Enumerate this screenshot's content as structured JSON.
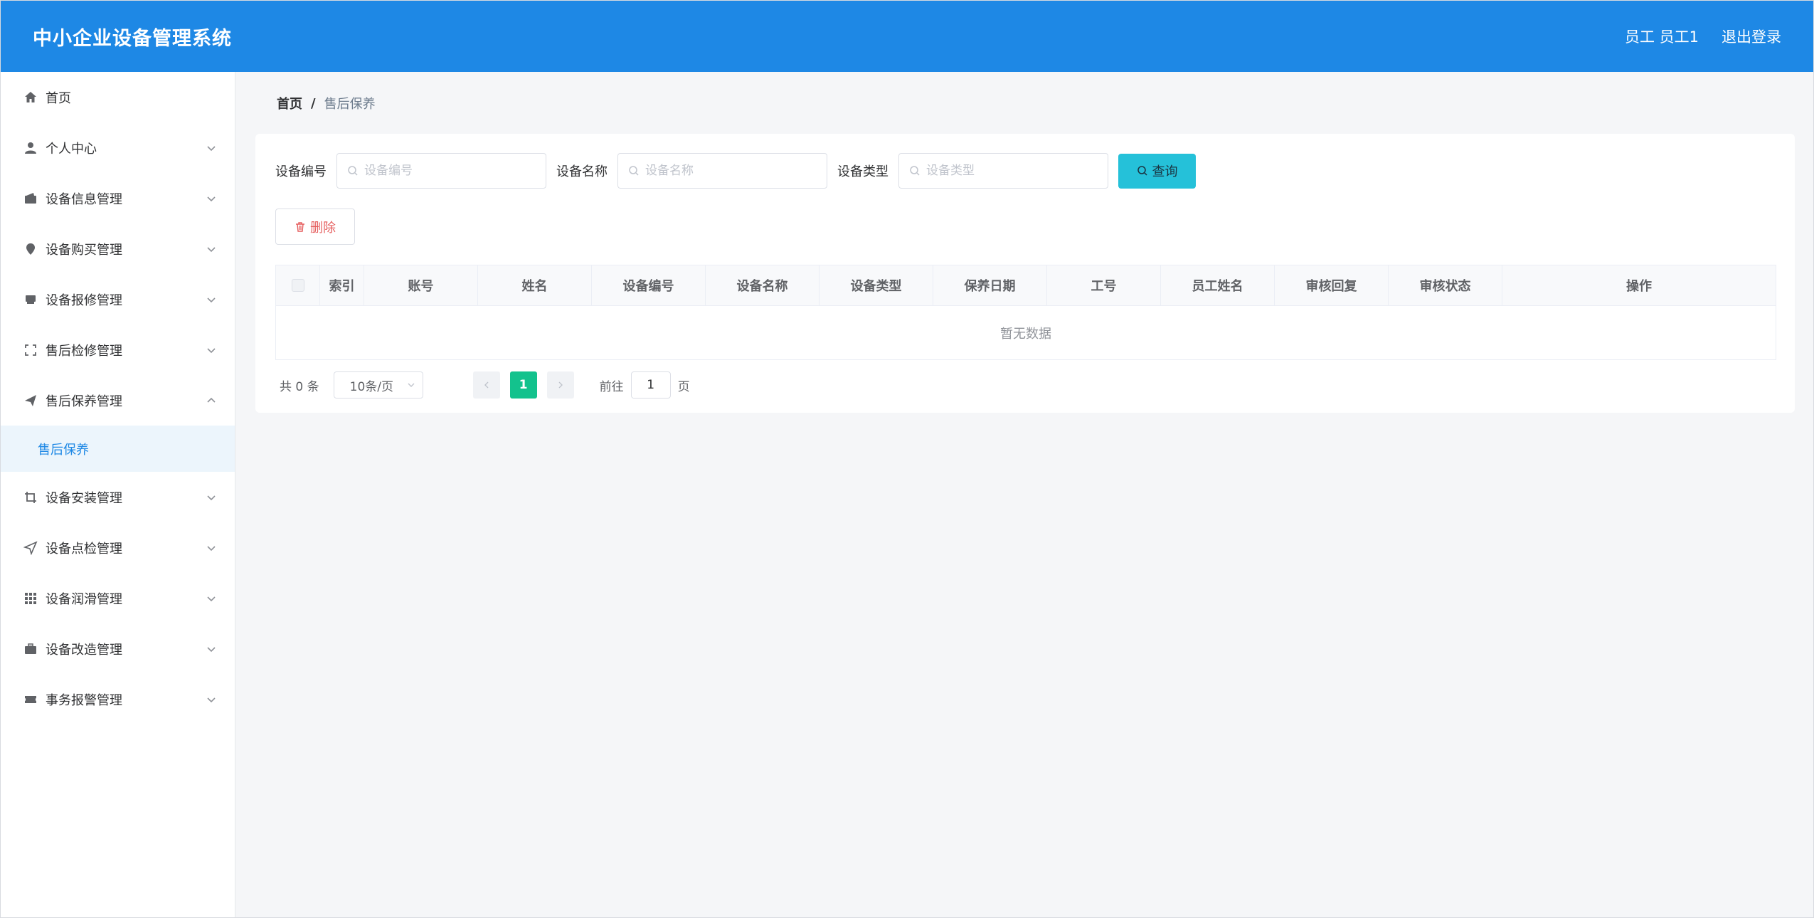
{
  "header": {
    "title": "中小企业设备管理系统",
    "user": "员工 员工1",
    "logout": "退出登录",
    "color": "#1e88e5"
  },
  "sidebar": {
    "items": [
      {
        "label": "首页",
        "icon": "home-icon"
      },
      {
        "label": "个人中心",
        "icon": "user-icon"
      },
      {
        "label": "设备信息管理",
        "icon": "wallet-icon"
      },
      {
        "label": "设备购买管理",
        "icon": "location-pin-icon"
      },
      {
        "label": "设备报修管理",
        "icon": "printer-icon"
      },
      {
        "label": "售后检修管理",
        "icon": "fullscreen-icon"
      },
      {
        "label": "售后保养管理",
        "icon": "send-icon"
      },
      {
        "label": "设备安装管理",
        "icon": "crop-icon"
      },
      {
        "label": "设备点检管理",
        "icon": "navigation-icon"
      },
      {
        "label": "设备润滑管理",
        "icon": "grid-icon"
      },
      {
        "label": "设备改造管理",
        "icon": "briefcase-icon"
      },
      {
        "label": "事务报警管理",
        "icon": "ticket-icon"
      }
    ],
    "active_sub": "售后保养"
  },
  "breadcrumb": {
    "home": "首页",
    "separator": "/",
    "current": "售后保养"
  },
  "search": {
    "fields": [
      {
        "label": "设备编号",
        "placeholder": "设备编号"
      },
      {
        "label": "设备名称",
        "placeholder": "设备名称"
      },
      {
        "label": "设备类型",
        "placeholder": "设备类型"
      }
    ],
    "query_label": "查询"
  },
  "toolbar": {
    "delete_label": "删除"
  },
  "table": {
    "columns": [
      "索引",
      "账号",
      "姓名",
      "设备编号",
      "设备名称",
      "设备类型",
      "保养日期",
      "工号",
      "员工姓名",
      "审核回复",
      "审核状态",
      "操作"
    ],
    "empty_text": "暂无数据"
  },
  "pagination": {
    "total": "共 0 条",
    "page_size": "10条/页",
    "current_page": "1",
    "goto_prefix": "前往",
    "goto_value": "1",
    "goto_suffix": "页"
  }
}
